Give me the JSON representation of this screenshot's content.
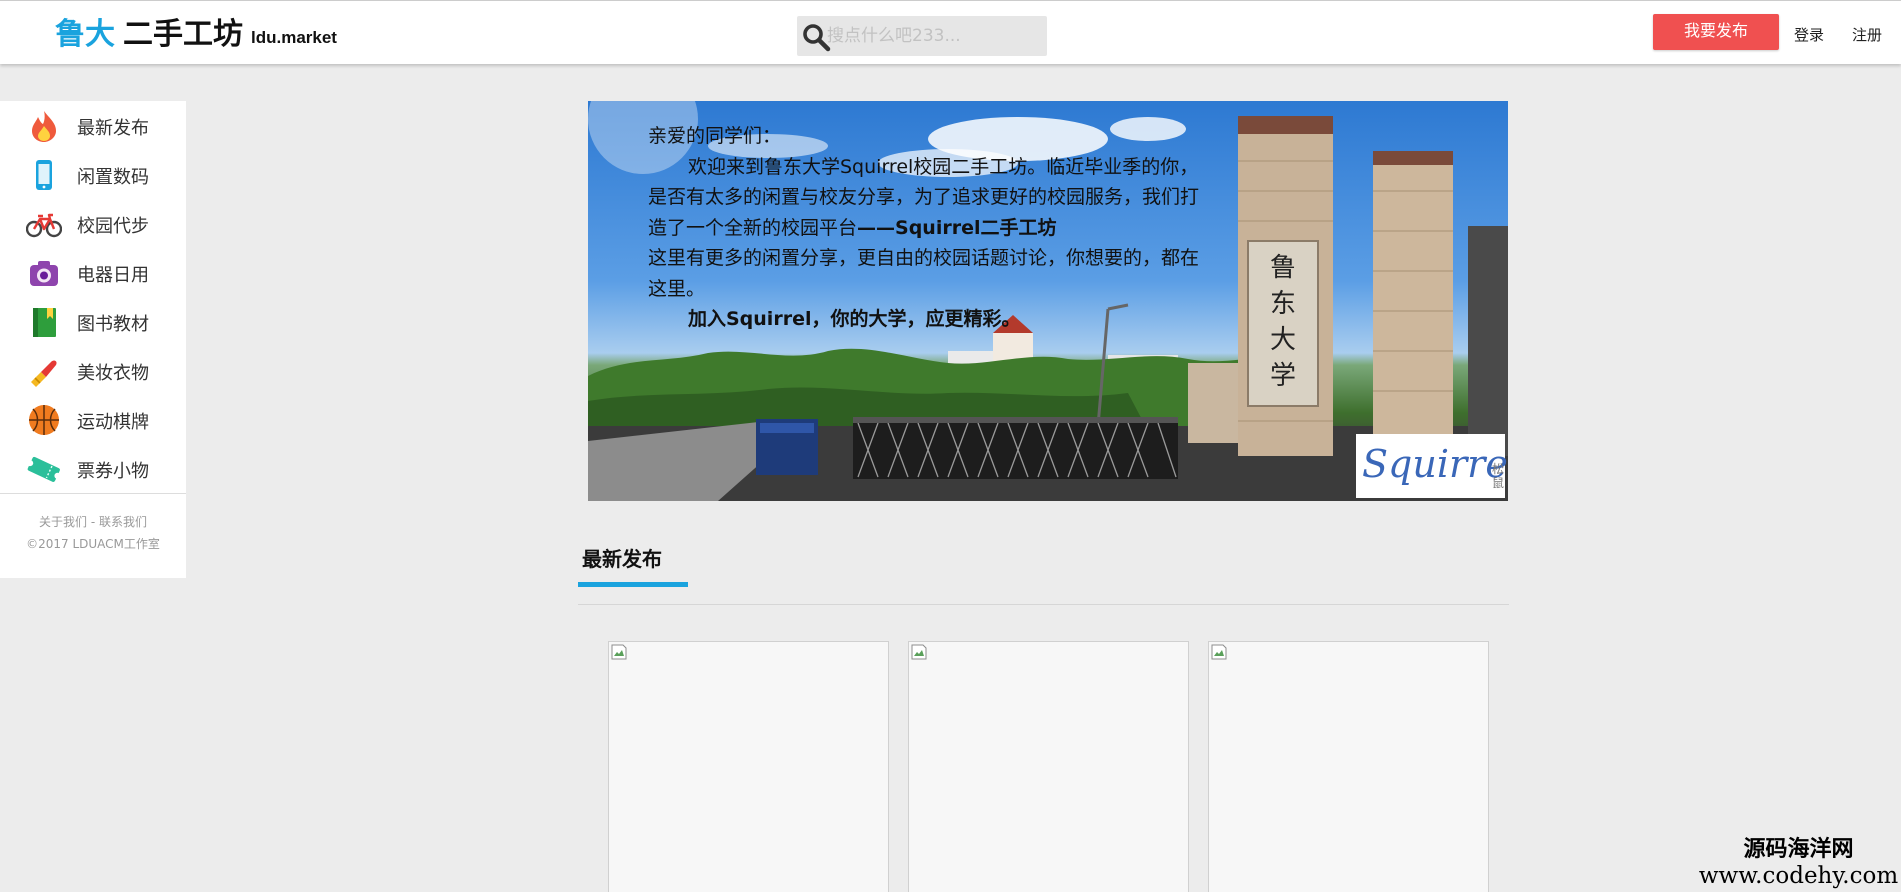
{
  "header": {
    "logo_brand": "鲁大",
    "logo_rest": "二手工坊",
    "domain": "ldu.market",
    "search_placeholder": "搜点什么吧233...",
    "publish_label": "我要发布",
    "login_label": "登录",
    "register_label": "注册"
  },
  "sidebar": {
    "items": [
      {
        "label": "最新发布",
        "icon": "flame-icon"
      },
      {
        "label": "闲置数码",
        "icon": "phone-icon"
      },
      {
        "label": "校园代步",
        "icon": "bicycle-icon"
      },
      {
        "label": "电器日用",
        "icon": "camera-icon"
      },
      {
        "label": "图书教材",
        "icon": "book-icon"
      },
      {
        "label": "美妆衣物",
        "icon": "lipstick-icon"
      },
      {
        "label": "运动棋牌",
        "icon": "basketball-icon"
      },
      {
        "label": "票券小物",
        "icon": "ticket-icon"
      }
    ],
    "footer_links": "关于我们 - 联系我们",
    "copyright": "©2017 LDUACM工作室"
  },
  "banner": {
    "greeting": "亲爱的同学们：",
    "para1_start": "欢迎来到鲁东大学Squirrel校园二手工坊。临近毕业季的你，是否有太多的闲置与校友分享，为了追求更好的校园服务，我们打造了一个全新的校园平台",
    "para1_bold": "——Squirrel二手工坊",
    "para2": "这里有更多的闲置分享，更自由的校园话题讨论，你想要的，都在这里。",
    "slogan": "加入Squirrel，你的大学，应更精彩。",
    "logo_word": "Squirrel",
    "logo_sub": "松鼠",
    "gate_inscription": "鲁东大学"
  },
  "section": {
    "title": "最新发布"
  },
  "watermark": {
    "cn": "源码海洋网",
    "url": "www.codehy.com"
  },
  "colors": {
    "accent": "#1aa3de",
    "publish_button": "#f05050",
    "page_bg": "#ececec"
  }
}
